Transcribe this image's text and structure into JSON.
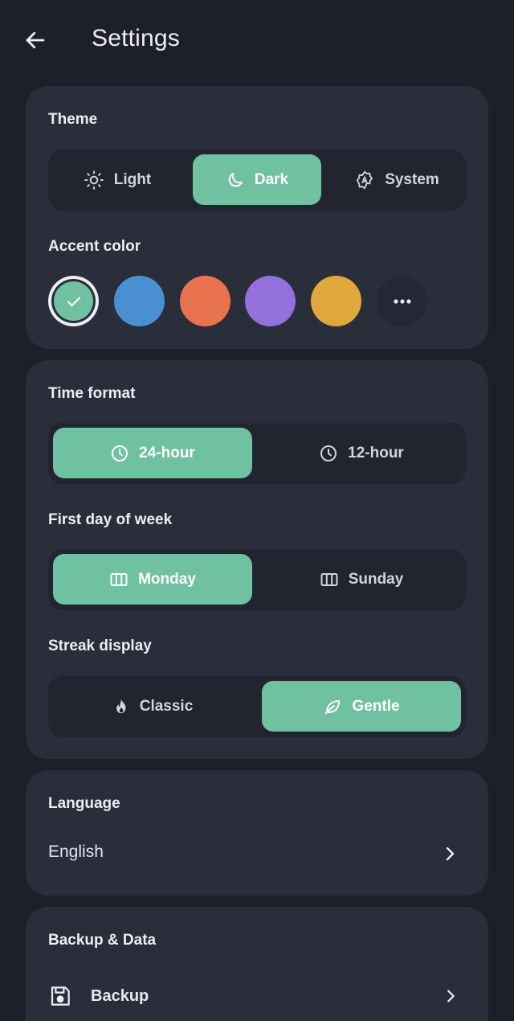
{
  "header": {
    "title": "Settings"
  },
  "theme": {
    "label": "Theme",
    "options": [
      {
        "label": "Light",
        "icon": "sun-icon"
      },
      {
        "label": "Dark",
        "icon": "moon-icon"
      },
      {
        "label": "System",
        "icon": "auto-theme-icon"
      }
    ],
    "selected": "Dark"
  },
  "accent": {
    "label": "Accent color",
    "colors": [
      "#6fc1a1",
      "#4a90d1",
      "#e8734e",
      "#9370db",
      "#e0a83c"
    ],
    "selected_index": 0,
    "more_icon": "more-horizontal-icon"
  },
  "time_format": {
    "label": "Time format",
    "options": [
      {
        "label": "24-hour",
        "icon": "clock-icon"
      },
      {
        "label": "12-hour",
        "icon": "clock-icon"
      }
    ],
    "selected": "24-hour"
  },
  "first_day": {
    "label": "First day of week",
    "options": [
      {
        "label": "Monday",
        "icon": "calendar-columns-icon"
      },
      {
        "label": "Sunday",
        "icon": "calendar-columns-icon"
      }
    ],
    "selected": "Monday"
  },
  "streak": {
    "label": "Streak display",
    "options": [
      {
        "label": "Classic",
        "icon": "flame-icon"
      },
      {
        "label": "Gentle",
        "icon": "leaf-icon"
      }
    ],
    "selected": "Gentle"
  },
  "language": {
    "label": "Language",
    "value": "English"
  },
  "backup": {
    "label": "Backup & Data",
    "items": [
      {
        "label": "Backup",
        "icon": "save-icon"
      }
    ]
  },
  "colors": {
    "accent": "#6fc1a1",
    "card": "#2a2d3a",
    "background": "#1e2029"
  }
}
